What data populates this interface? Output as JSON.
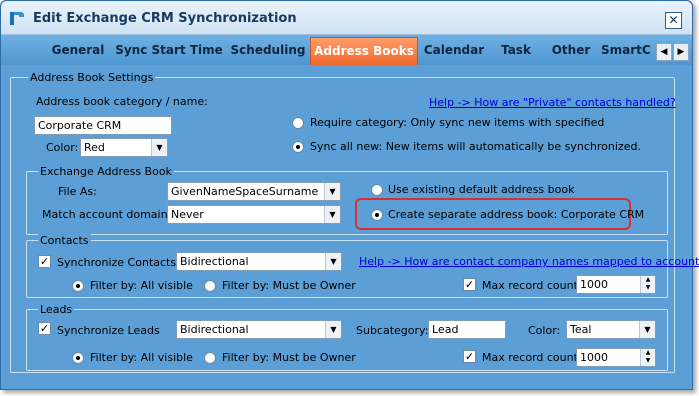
{
  "window": {
    "title": "Edit Exchange CRM Synchronization",
    "close_label": "✕"
  },
  "tabs": [
    {
      "label": "General"
    },
    {
      "label": "Sync Start Time"
    },
    {
      "label": "Scheduling"
    },
    {
      "label": "Address Books",
      "active": true
    },
    {
      "label": "Calendar"
    },
    {
      "label": "Task"
    },
    {
      "label": "Other"
    },
    {
      "label": "SmartC"
    }
  ],
  "tab_scroll": {
    "left": "◀",
    "right": "▶"
  },
  "address_book_settings": {
    "legend": "Address Book Settings",
    "category_label": "Address book category / name:",
    "category_value": "Corporate CRM",
    "color_label": "Color:",
    "color_value": "Red",
    "help_link": "Help -> How are \"Private\" contacts handled?",
    "require_category_label": "Require category: Only sync new items with specified",
    "sync_all_new_label": "Sync all new: New items will automatically be synchronized."
  },
  "exchange_address_book": {
    "legend": "Exchange Address Book",
    "file_as_label": "File As:",
    "file_as_value": "GivenNameSpaceSurname",
    "match_domain_label": "Match account domain:",
    "match_domain_value": "Never",
    "use_existing_label": "Use existing default address book",
    "create_separate_label": "Create separate address book: Corporate CRM"
  },
  "contacts": {
    "legend": "Contacts",
    "sync_label": "Synchronize Contacts",
    "direction_value": "Bidirectional",
    "help_link": "Help -> How are contact company names mapped to accounts?",
    "filter_all_label": "Filter by: All visible",
    "filter_owner_label": "Filter by: Must be Owner",
    "max_label": "Max record count:",
    "max_value": "1000"
  },
  "leads": {
    "legend": "Leads",
    "sync_label": "Synchronize Leads",
    "direction_value": "Bidirectional",
    "subcategory_label": "Subcategory:",
    "subcategory_value": "Lead",
    "color_label": "Color:",
    "color_value": "Teal",
    "filter_all_label": "Filter by: All visible",
    "filter_owner_label": "Filter by: Must be Owner",
    "max_label": "Max record count:",
    "max_value": "1000"
  },
  "glyphs": {
    "dropdown": "▼",
    "check": "✓",
    "spin_up": "▲",
    "spin_down": "▼"
  },
  "colors": {
    "window_bg": "#5b9fd6",
    "active_tab": "#f06a2d",
    "highlight": "#d83030"
  }
}
